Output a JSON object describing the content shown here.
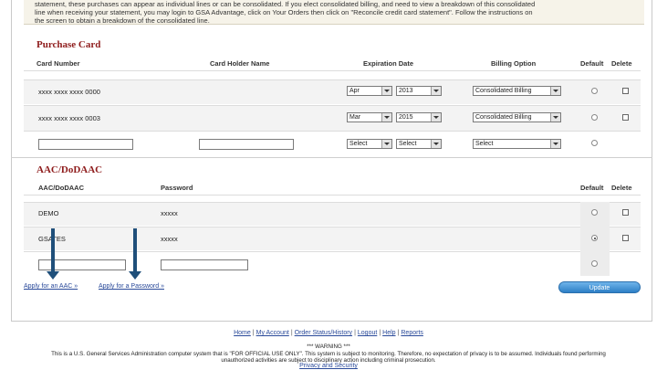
{
  "notice": {
    "line1": "statement, these purchases can appear as individual lines or can be consolidated. If you elect consolidated billing, and need to view a breakdown of this consolidated",
    "line2": "line when receiving your statement, you may login to GSA Advantage, click on Your Orders then click on \"Reconcile credit card statement\". Follow the instructions on",
    "line3": "the screen to obtain a breakdown of the consolidated line."
  },
  "purchase_card": {
    "title": "Purchase Card",
    "headers": {
      "card_number": "Card Number",
      "holder": "Card Holder Name",
      "expiration": "Expiration Date",
      "billing": "Billing Option",
      "default": "Default",
      "delete": "Delete"
    },
    "rows": [
      {
        "number": "xxxx xxxx xxxx 0000",
        "month": "Apr",
        "year": "2013",
        "billing": "Consolidated Billing",
        "default": false
      },
      {
        "number": "xxxx xxxx xxxx 0003",
        "month": "Mar",
        "year": "2015",
        "billing": "Consolidated Billing",
        "default": false
      }
    ],
    "new_row": {
      "month": "Select",
      "year": "Select",
      "billing": "Select"
    }
  },
  "aac": {
    "title": "AAC/DoDAAC",
    "headers": {
      "aac": "AAC/DoDAAC",
      "password": "Password",
      "default": "Default",
      "delete": "Delete"
    },
    "rows": [
      {
        "aac": "DEMO",
        "password": "xxxxx",
        "default": false
      },
      {
        "aac": "GSATES",
        "password": "xxxxx",
        "default": true
      }
    ],
    "apply_aac": "Apply for an AAC »",
    "apply_password": "Apply for a Password »",
    "update_label": "Update"
  },
  "footer": {
    "links": [
      "Home",
      "My Account",
      "Order Status/History",
      "Logout",
      "Help",
      "Reports"
    ],
    "warning_title": "*** WARNING ***",
    "warning_line1": "This is a U.S. General Services Administration computer system that is \"FOR OFFICIAL USE ONLY\". This system is subject to monitoring. Therefore, no expectation of privacy is to be assumed. Individuals found performing",
    "warning_line2": "unauthorized activities are subject to disciplinary action including criminal prosecution.",
    "privacy": "Privacy and Security"
  },
  "colors": {
    "section_title": "#8e1b1b",
    "link": "#2a4a9a",
    "button": "#2d7fc6",
    "arrow": "#1f4f7a"
  }
}
